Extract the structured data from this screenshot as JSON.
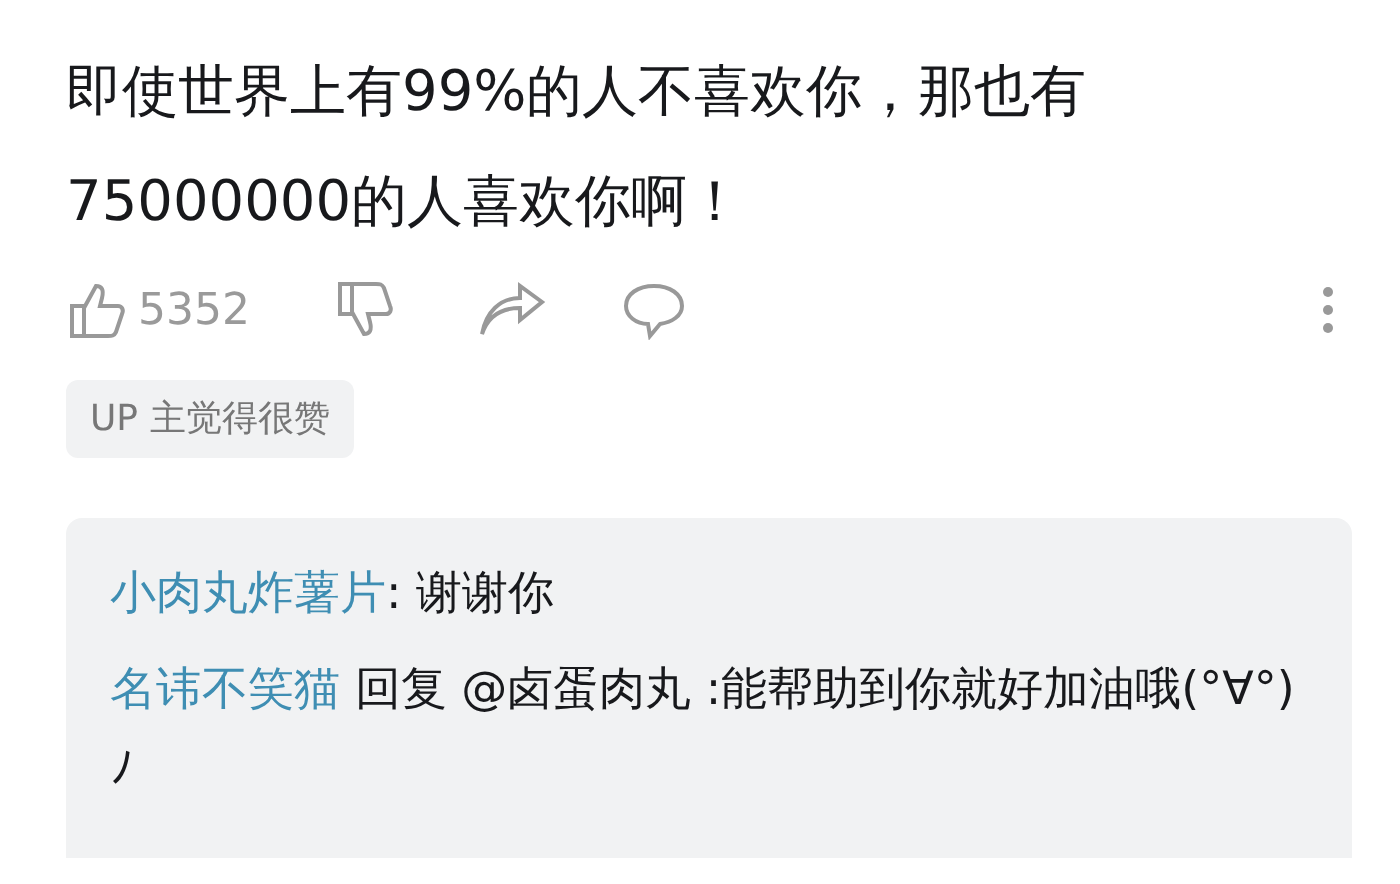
{
  "comment": {
    "text": "即使世界上有99%的人不喜欢你，那也有75000000的人喜欢你啊！"
  },
  "actions": {
    "like_count": "5352"
  },
  "badge": "UP 主觉得很赞",
  "replies": [
    {
      "author": "小肉丸炸薯片",
      "text": ": 谢谢你"
    },
    {
      "author": "名讳不笑猫",
      "text": " 回复 @卤蛋肉丸 :能帮助到你就好加油哦(°∀°)ﾉ"
    }
  ]
}
